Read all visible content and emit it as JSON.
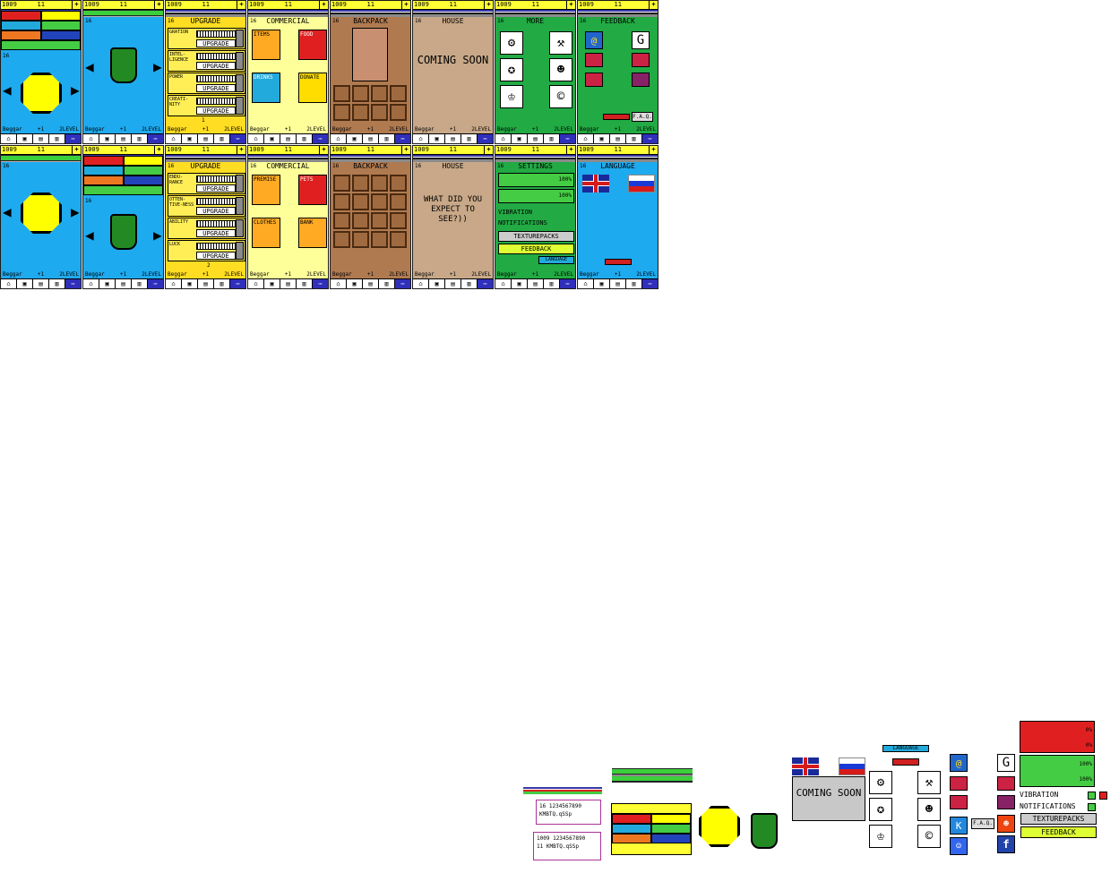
{
  "status": {
    "coins": "1009",
    "gems": "11",
    "plus": "+",
    "rank": "16"
  },
  "player": {
    "name": "Beggar",
    "level": "2LEVEL",
    "bonus": "+1"
  },
  "screens": {
    "upgrade": {
      "title": "UPGRADE",
      "page1": "1",
      "page2": "2",
      "rows1": [
        {
          "label": "GRATION"
        },
        {
          "label": "INTEL-LIGENCE"
        },
        {
          "label": "POWER"
        },
        {
          "label": "CREATI-NITY"
        }
      ],
      "rows2": [
        {
          "label": "ENDU-RANCE"
        },
        {
          "label": "OTTEN-TIVE-NESS"
        },
        {
          "label": "ABILITY"
        },
        {
          "label": "LUCK"
        }
      ],
      "button": "UPGRADE"
    },
    "commercial": {
      "title": "COMMERCIAL",
      "tiles1": [
        "ITEMS",
        "FOOD",
        "DRINKS",
        "DONATE"
      ],
      "tiles2": [
        "PREMISE",
        "PETS",
        "CLOTHES",
        "BANK"
      ]
    },
    "backpack": {
      "title": "BACKPACK"
    },
    "house": {
      "title": "HOUSE",
      "coming_soon": "COMING SOON",
      "easter": "WHAT DID YOU EXPECT TO SEE?))"
    },
    "more": {
      "title": "MORE"
    },
    "feedback": {
      "title": "FEEDBACK",
      "faq": "F.A.Q."
    },
    "settings": {
      "title": "SETTINGS",
      "music": "100%",
      "sound": "100%",
      "vibration": "VIBRATION",
      "notifications": "NOTIFICATIONS",
      "texturepacks": "TEXTUREPACKS",
      "feedback": "FEEDBACK",
      "language": "LANGUAGE"
    },
    "language": {
      "title": "LANGUAGE"
    }
  },
  "sheet": {
    "language_tab": "LANGUAGE",
    "coming_soon": "COMING SOON",
    "faq": "F.A.Q.",
    "digits": "1234567890",
    "letters": "KMBTQ.qSSp",
    "rank": "16",
    "coins": "1009",
    "gems": "11",
    "music_off": "0%",
    "sound_off": "0%",
    "music_on": "100%",
    "sound_on": "100%",
    "vibration": "VIBRATION",
    "notifications": "NOTIFICATIONS",
    "texturepacks": "TEXTUREPACKS",
    "feedback": "FEEDBACK"
  },
  "colors": {
    "sky": "#1eaaee",
    "grass": "#22aa44",
    "paper": "#ffff99",
    "yellow": "#ffff33",
    "brown": "#b07a50",
    "tan": "#c8a888"
  }
}
